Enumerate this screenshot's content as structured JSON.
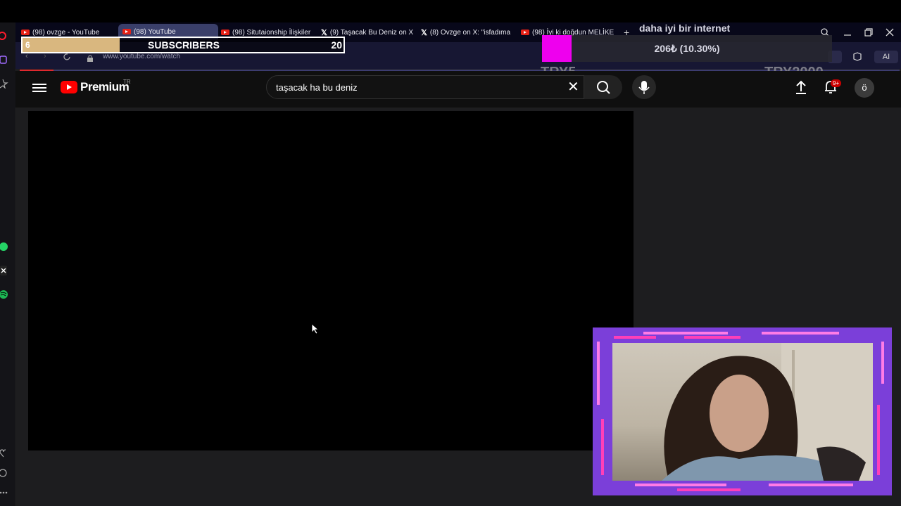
{
  "tabs": [
    {
      "label": "(98) ovzge - YouTube",
      "icon": "youtube-icon"
    },
    {
      "label": "(98) YouTube",
      "icon": "youtube-icon",
      "active": true
    },
    {
      "label": "(98) Situtaionship İlişkiler",
      "icon": "youtube-icon"
    },
    {
      "label": "(9) Taşacak Bu Deniz on X",
      "icon": "x-icon"
    },
    {
      "label": "(8) Ovzge on X: \"isfadıma",
      "icon": "x-icon"
    },
    {
      "label": "(98) İyi ki doğdun MELİKE",
      "icon": "youtube-icon"
    }
  ],
  "address": {
    "url": "www.youtube.com/watch"
  },
  "subscriber_goal": {
    "current": "6",
    "label": "SUBSCRIBERS",
    "goal": "20",
    "progress": 0.3
  },
  "donation_goal": {
    "title": "daha iyi bir internet",
    "amount": "206₺ (10.30%)",
    "min": "TRY5",
    "max": "TRY2000",
    "progress": 0.103
  },
  "youtube": {
    "logo_text": "Premium",
    "country": "TR",
    "search_value": "taşacak ha bu deniz",
    "notification_count": "9+",
    "avatar_letter": "ö"
  },
  "browser_right": {
    "ai_label": "AI"
  },
  "colors": {
    "accent_pink": "#ee00ee",
    "frame_purple": "#7b3fd9",
    "youtube_red": "#ff0000"
  }
}
